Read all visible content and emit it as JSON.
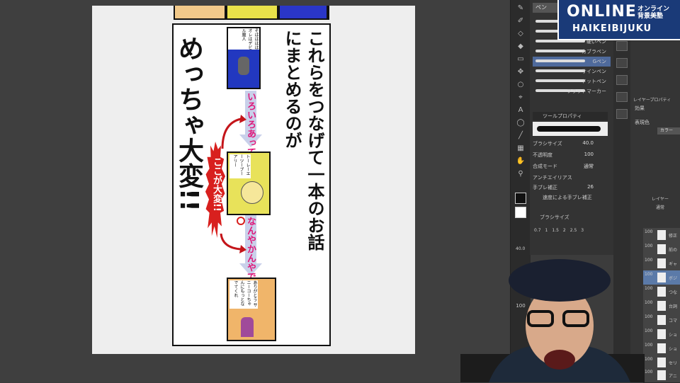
{
  "manga": {
    "headline": "これらをつなげて一本のお話にまとめるのが",
    "emphasis": "めっちゃ大変!!",
    "label_iroiro": "いろいろあって",
    "label_nanyakanya": "なんやかんやで",
    "burst_text": "ここが大変!!",
    "panel1_speech": "そはははは オレはデビル魔人",
    "panel2_speech": "トーレーエーツーブーアリー",
    "panel3_speech": "ありがとう サニーコーちゃんにもっとなでてくれ"
  },
  "app": {
    "brush_tab": "ペン",
    "brushes": [
      {
        "label": ""
      },
      {
        "label": ""
      },
      {
        "label": "硬いペン"
      },
      {
        "label": "カブラペン"
      },
      {
        "label": "Gペン"
      },
      {
        "label": "サインペン"
      },
      {
        "label": "ドットペン"
      },
      {
        "label": "フラットマーカー"
      }
    ],
    "tool_property_title": "ツールプロパティ",
    "properties": [
      {
        "label": "ブラシサイズ",
        "value": "40.0"
      },
      {
        "label": "不透明度",
        "value": "100"
      },
      {
        "label": "合成モード",
        "value": "通常"
      },
      {
        "label": "アンチエイリアス",
        "value": ""
      },
      {
        "label": "手ブレ補正",
        "value": "26"
      },
      {
        "label": "速度による手ブレ補正",
        "value": ""
      }
    ],
    "brush_size_title": "ブラシサイズ",
    "brush_sizes": [
      "0.7",
      "1",
      "1.5",
      "2",
      "2.5",
      "3"
    ],
    "size_readout": "40.0",
    "layer_property_title": "レイヤープロパティ",
    "effect_label": "効果",
    "display_color_label": "表現色",
    "color_value": "カラー",
    "layer_title": "レイヤー",
    "blend_mode": "通常",
    "layers": [
      {
        "opacity": "100",
        "name": "修正"
      },
      {
        "opacity": "100",
        "name": "前の"
      },
      {
        "opacity": "100",
        "name": "ギャ"
      },
      {
        "opacity": "100",
        "name": "ボジ"
      },
      {
        "opacity": "100",
        "name": "つな"
      },
      {
        "opacity": "100",
        "name": "台詞"
      },
      {
        "opacity": "100",
        "name": "コマ"
      },
      {
        "opacity": "100",
        "name": "ショ"
      },
      {
        "opacity": "100",
        "name": "ショ"
      },
      {
        "opacity": "100",
        "name": "セリ"
      },
      {
        "opacity": "100",
        "name": "アニ"
      }
    ],
    "zoom": "100"
  },
  "banner": {
    "title": "ONLINE",
    "subtitle": "HAIKEIBIJUKU",
    "jp_line1": "オンライン",
    "jp_line2": "背景美塾"
  },
  "colors": {
    "accent_pink": "#e0187a",
    "burst_red": "#d8201e",
    "banner_blue": "#1a3a78",
    "arrow": "#c9d0ea"
  }
}
